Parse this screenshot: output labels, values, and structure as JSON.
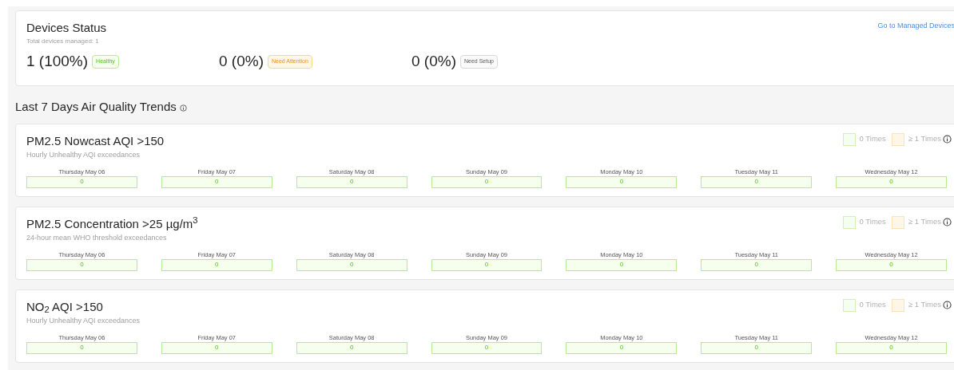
{
  "devices_status": {
    "title": "Devices Status",
    "subtitle": "Total devices managed: 1",
    "link": "Go to Managed Devices",
    "items": [
      {
        "count": "1 (100%)",
        "badge": "Healthy",
        "kind": "healthy"
      },
      {
        "count": "0 (0%)",
        "badge": "Need Attention",
        "kind": "attention"
      },
      {
        "count": "0 (0%)",
        "badge": "Need Setup",
        "kind": "setup"
      }
    ]
  },
  "trends_heading": "Last 7 Days Air Quality Trends",
  "trend_cards": [
    {
      "title": "PM2.5 Nowcast AQI >150",
      "subtitle": "Hourly Unhealthy AQI exceedances",
      "legend": [
        "0 Times",
        "≥ 1 Times"
      ],
      "days": [
        {
          "date": "Thursday May 06",
          "value": "0"
        },
        {
          "date": "Friday May 07",
          "value": "0"
        },
        {
          "date": "Saturday May 08",
          "value": "0"
        },
        {
          "date": "Sunday May 09",
          "value": "0"
        },
        {
          "date": "Monday May 10",
          "value": "0"
        },
        {
          "date": "Tuesday May 11",
          "value": "0"
        },
        {
          "date": "Wednesday May 12",
          "value": "0"
        }
      ]
    },
    {
      "title": "PM2.5 Concentration >25 µg/m$^{3}$",
      "subtitle": "24-hour mean WHO threshold exceedances",
      "legend": [
        "0 Times",
        "≥ 1 Times"
      ],
      "days": [
        {
          "date": "Thursday May 06",
          "value": "0"
        },
        {
          "date": "Friday May 07",
          "value": "0"
        },
        {
          "date": "Saturday May 08",
          "value": "0"
        },
        {
          "date": "Sunday May 09",
          "value": "0"
        },
        {
          "date": "Monday May 10",
          "value": "0"
        },
        {
          "date": "Tuesday May 11",
          "value": "0"
        },
        {
          "date": "Wednesday May 12",
          "value": "0"
        }
      ]
    },
    {
      "title": "NO$_{2}$ AQI >150",
      "subtitle": "Hourly Unhealthy AQI exceedances",
      "legend": [
        "0 Times",
        "≥ 1 Times"
      ],
      "days": [
        {
          "date": "Thursday May 06",
          "value": "0"
        },
        {
          "date": "Friday May 07",
          "value": "0"
        },
        {
          "date": "Saturday May 08",
          "value": "0"
        },
        {
          "date": "Sunday May 09",
          "value": "0"
        },
        {
          "date": "Monday May 10",
          "value": "0"
        },
        {
          "date": "Tuesday May 11",
          "value": "0"
        },
        {
          "date": "Wednesday May 12",
          "value": "0"
        }
      ]
    }
  ]
}
